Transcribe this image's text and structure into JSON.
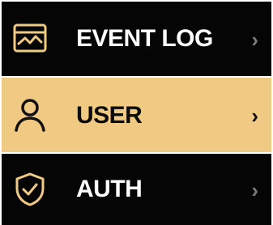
{
  "colors": {
    "background": "#050505",
    "active_background": "#f0c983",
    "active_text": "#0b0b0b",
    "inactive_text": "#ffffff",
    "icon_active_stroke": "#111111",
    "icon_inactive_stroke": "#f0c983",
    "chevron_inactive": "#7a7a7a"
  },
  "menu": {
    "items": [
      {
        "label": "EVENT LOG",
        "icon": "event-log-icon",
        "chevron": "›",
        "active": false
      },
      {
        "label": "USER",
        "icon": "user-icon",
        "chevron": "›",
        "active": true
      },
      {
        "label": "AUTH",
        "icon": "shield-check-icon",
        "chevron": "›",
        "active": false
      }
    ]
  }
}
